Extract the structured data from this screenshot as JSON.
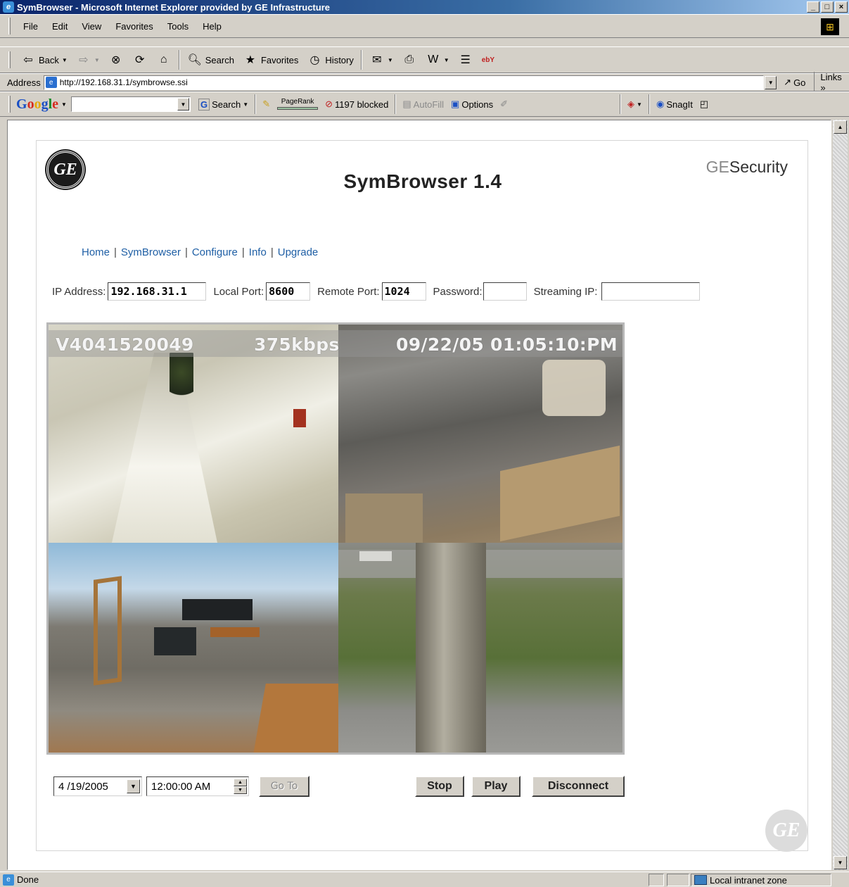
{
  "window": {
    "title": "SymBrowser - Microsoft Internet Explorer provided by GE Infrastructure",
    "controls": [
      "_",
      "□",
      "×"
    ]
  },
  "menubar": {
    "items": [
      "File",
      "Edit",
      "View",
      "Favorites",
      "Tools",
      "Help"
    ]
  },
  "toolbar": {
    "back_label": "Back",
    "search_label": "Search",
    "favorites_label": "Favorites",
    "history_label": "History",
    "ebay_label": "ebY"
  },
  "addressbar": {
    "label": "Address",
    "url": "http://192.168.31.1/symbrowse.ssi",
    "go_label": "Go",
    "links_label": "Links »"
  },
  "googlebar": {
    "logo": "Google",
    "search_label": "Search",
    "pagerank_label": "PageRank",
    "blocked_label": "1197 blocked",
    "autofill_label": "AutoFill",
    "options_label": "Options",
    "snagit_label": "SnagIt"
  },
  "page": {
    "logo_text": "GE",
    "title": "SymBrowser 1.4",
    "brand_ge": "GE",
    "brand_security": "Security",
    "nav": [
      "Home",
      "SymBrowser",
      "Configure",
      "Info",
      "Upgrade"
    ],
    "connection": {
      "ip_label": "IP Address:",
      "ip_value": "192.168.31.1",
      "local_port_label": "Local Port:",
      "local_port_value": "8600",
      "remote_port_label": "Remote Port:",
      "remote_port_value": "1024",
      "password_label": "Password:",
      "password_value": "",
      "streaming_ip_label": "Streaming IP:",
      "streaming_ip_value": ""
    },
    "video": {
      "camera_id": "V4041520049",
      "bitrate": "375kbps",
      "timestamp": "09/22/05 01:05:10:PM"
    },
    "playback": {
      "date_value": "4 /19/2005",
      "time_value": "12:00:00 AM",
      "goto_label": "Go To",
      "stop_label": "Stop",
      "play_label": "Play",
      "disconnect_label": "Disconnect"
    }
  },
  "statusbar": {
    "status": "Done",
    "zone": "Local intranet zone"
  }
}
